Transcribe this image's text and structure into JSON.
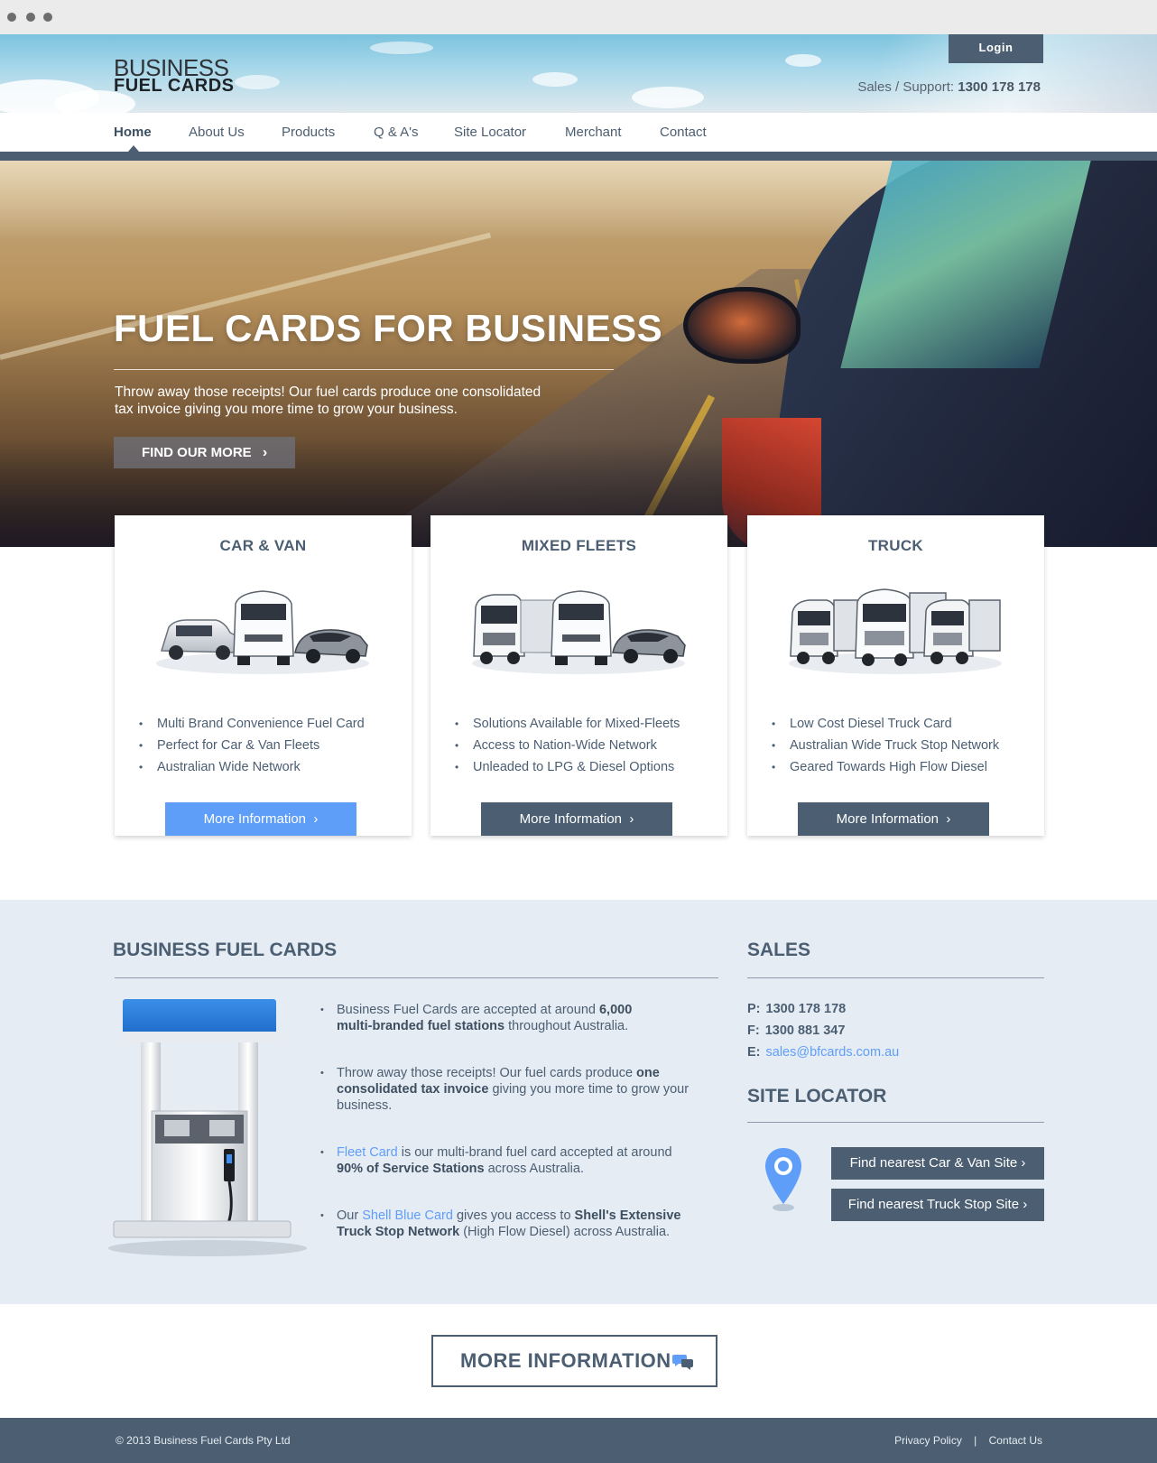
{
  "brand": {
    "logo_line1": "BUSINESS",
    "logo_line2": "FUEL CARDS"
  },
  "header": {
    "login_label": "Login",
    "support_label": "Sales / Support:",
    "support_phone": "1300 178 178"
  },
  "nav": {
    "items": [
      {
        "label": "Home",
        "active": true
      },
      {
        "label": "About Us"
      },
      {
        "label": "Products"
      },
      {
        "label": "Q & A's"
      },
      {
        "label": "Site Locator"
      },
      {
        "label": "Merchant"
      },
      {
        "label": "Contact"
      }
    ]
  },
  "hero": {
    "title": "FUEL CARDS FOR BUSINESS",
    "subtitle_line1": "Throw away those receipts! Our fuel cards produce one consolidated",
    "subtitle_line2": "tax invoice giving you more time to grow your business.",
    "cta_label": "FIND OUR MORE",
    "cta_icon": "chevron-right-icon"
  },
  "cards": [
    {
      "title": "CAR & VAN",
      "image": "car-and-van-vehicles-image",
      "features": [
        "Multi Brand Convenience Fuel Card",
        "Perfect for Car & Van Fleets",
        "Australian Wide Network"
      ],
      "button_label": "More Information",
      "button_color": "#5f9ef8"
    },
    {
      "title": "MIXED FLEETS",
      "image": "mixed-fleet-vehicles-image",
      "features": [
        "Solutions Available for Mixed-Fleets",
        "Access to Nation-Wide Network",
        "Unleaded to LPG & Diesel Options"
      ],
      "button_label": "More Information",
      "button_color": "#4b5e72"
    },
    {
      "title": "TRUCK",
      "image": "trucks-image",
      "features": [
        "Low Cost Diesel Truck Card",
        "Australian Wide Truck Stop Network",
        "Geared Towards High Flow Diesel"
      ],
      "button_label": "More Information",
      "button_color": "#4b5e72"
    }
  ],
  "info": {
    "title": "BUSINESS FUEL CARDS",
    "image": "fuel-pump-image",
    "bullets": [
      {
        "pre": "Business Fuel Cards are accepted at around ",
        "bold": "6,000",
        "line2_bold": "multi-branded fuel stations",
        "post": " throughout Australia."
      },
      {
        "pre": "Throw away those receipts! Our fuel cards produce ",
        "bold": "one",
        "line2_bold": "consolidated tax invoice",
        "post": " giving you more time to grow your business."
      },
      {
        "link": "Fleet Card",
        "pre": " is our multi-brand fuel card accepted at around",
        "line2_bold": "90% of Service Stations",
        "post": " across Australia."
      },
      {
        "pre": "Our ",
        "link": "Shell Blue Card",
        "mid": " gives you access to ",
        "bold": "Shell's Extensive",
        "line2_bold": "Truck Stop Network",
        "post": " (High Flow Diesel) across Australia."
      }
    ]
  },
  "sales": {
    "title": "SALES",
    "phone_label": "P:",
    "phone": "1300 178 178",
    "fax_label": "F:",
    "fax": "1300 881 347",
    "email_label": "E:",
    "email": "sales@bfcards.com.au"
  },
  "site_locator": {
    "title": "SITE LOCATOR",
    "icon": "map-pin-icon",
    "car_van_button": "Find nearest Car & Van Site",
    "truck_button": "Find nearest Truck Stop Site"
  },
  "more_info": {
    "label": "MORE INFORMATION",
    "icon": "chat-bubbles-icon"
  },
  "footer": {
    "copyright": "© 2013 Business Fuel Cards Pty Ltd",
    "privacy": "Privacy Policy",
    "separator": "|",
    "contact": "Contact Us"
  },
  "colors": {
    "brand": "#4b5e72",
    "accent_blue": "#5f9ef8",
    "info_bg": "#e5ecf4",
    "footer_bg": "#4b5e72"
  }
}
